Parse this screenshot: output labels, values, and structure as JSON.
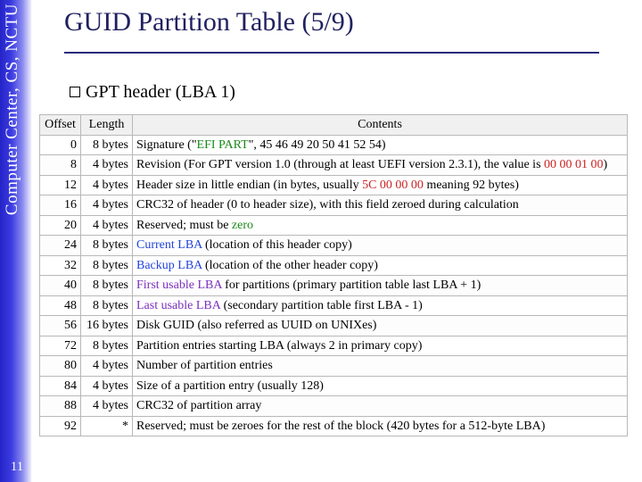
{
  "sidebar": {
    "text": "Computer Center, CS, NCTU"
  },
  "page_number": "11",
  "title": "GUID Partition Table (5/9)",
  "subtitle": "GPT header (LBA 1)",
  "headers": {
    "offset": "Offset",
    "length": "Length",
    "contents": "Contents"
  },
  "rows": [
    {
      "offset": "0",
      "length": "8 bytes",
      "contents_a": "Signature (\"",
      "hi": "EFI PART",
      "cls": "hi-green",
      "contents_b": "\", 45 46 49 20 50 41 52 54)"
    },
    {
      "offset": "8",
      "length": "4 bytes",
      "contents_a": "Revision (For GPT version 1.0 (through at least UEFI version 2.3.1), the value is ",
      "hi": "00 00 01 00",
      "cls": "hi-red",
      "contents_b": ")"
    },
    {
      "offset": "12",
      "length": "4 bytes",
      "contents_a": "Header size in little endian (in bytes, usually ",
      "hi": "5C 00 00 00",
      "cls": "hi-red",
      "contents_b": " meaning 92 bytes)"
    },
    {
      "offset": "16",
      "length": "4 bytes",
      "contents_a": "CRC32 of header (0 to header size), with this field zeroed during calculation",
      "hi": "",
      "cls": "",
      "contents_b": ""
    },
    {
      "offset": "20",
      "length": "4 bytes",
      "contents_a": "Reserved; must be ",
      "hi": "zero",
      "cls": "hi-green",
      "contents_b": ""
    },
    {
      "offset": "24",
      "length": "8 bytes",
      "contents_a": "",
      "hi": "Current LBA",
      "cls": "hi-blue",
      "contents_b": " (location of this header copy)"
    },
    {
      "offset": "32",
      "length": "8 bytes",
      "contents_a": "",
      "hi": "Backup LBA",
      "cls": "hi-blue",
      "contents_b": " (location of the other header copy)"
    },
    {
      "offset": "40",
      "length": "8 bytes",
      "contents_a": "",
      "hi": "First usable LBA",
      "cls": "hi-purple",
      "contents_b": " for partitions (primary partition table last LBA + 1)"
    },
    {
      "offset": "48",
      "length": "8 bytes",
      "contents_a": "",
      "hi": "Last usable LBA",
      "cls": "hi-purple",
      "contents_b": " (secondary partition table first LBA - 1)"
    },
    {
      "offset": "56",
      "length": "16 bytes",
      "contents_a": "Disk GUID (also referred as UUID on UNIXes)",
      "hi": "",
      "cls": "",
      "contents_b": ""
    },
    {
      "offset": "72",
      "length": "8 bytes",
      "contents_a": "Partition entries starting LBA (always 2 in primary copy)",
      "hi": "",
      "cls": "",
      "contents_b": ""
    },
    {
      "offset": "80",
      "length": "4 bytes",
      "contents_a": "Number of partition entries",
      "hi": "",
      "cls": "",
      "contents_b": ""
    },
    {
      "offset": "84",
      "length": "4 bytes",
      "contents_a": "Size of a partition entry (usually 128)",
      "hi": "",
      "cls": "",
      "contents_b": ""
    },
    {
      "offset": "88",
      "length": "4 bytes",
      "contents_a": "CRC32 of partition array",
      "hi": "",
      "cls": "",
      "contents_b": ""
    },
    {
      "offset": "92",
      "length": "*",
      "contents_a": "Reserved; must be zeroes for the rest of the block (420 bytes for a 512-byte LBA)",
      "hi": "",
      "cls": "",
      "contents_b": ""
    }
  ]
}
